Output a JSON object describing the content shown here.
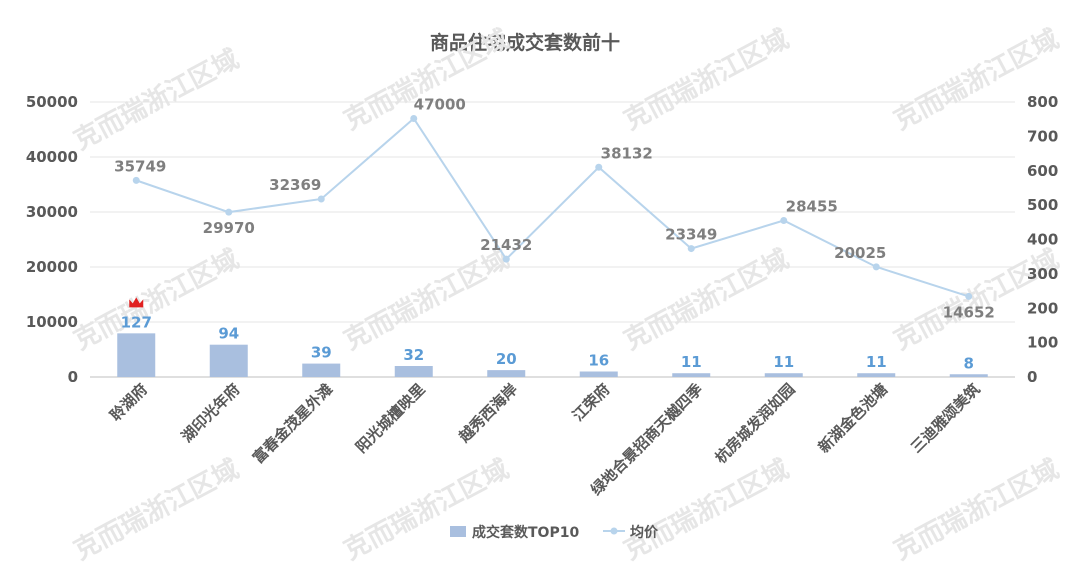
{
  "chart_data": {
    "type": "bar+line",
    "title": "商品住宅成交套数前十",
    "categories": [
      "聆湖府",
      "湖印光年府",
      "富春金茂星外滩",
      "阳光城檀映里",
      "越秀西海岸",
      "江荣府",
      "绿地合景招商天樾四季",
      "杭房城发润如园",
      "新湖金色池塘",
      "三迪雅颂美筑"
    ],
    "series": [
      {
        "name": "成交套数TOP10",
        "type": "bar",
        "axis": "right",
        "values": [
          127,
          94,
          39,
          32,
          20,
          16,
          11,
          11,
          11,
          8
        ]
      },
      {
        "name": "均价",
        "type": "line",
        "axis": "left",
        "values": [
          35749,
          29970,
          32369,
          47000,
          21432,
          38132,
          23349,
          28455,
          20025,
          14652
        ]
      }
    ],
    "left_axis": {
      "min": 0,
      "max": 50000,
      "ticks": [
        0,
        10000,
        20000,
        30000,
        40000,
        50000
      ]
    },
    "right_axis": {
      "min": 0,
      "max": 800,
      "ticks": [
        0,
        100,
        200,
        300,
        400,
        500,
        600,
        700,
        800
      ]
    },
    "grid": true,
    "legend": "bottom",
    "colors": {
      "bar": "#a9bfdf",
      "line": "#b8d4ec",
      "bar_label": "#5b9bd5",
      "line_label": "#7f7f7f",
      "crown": "#e02020"
    },
    "top_marker_icon": "crown-icon"
  },
  "watermark": "克而瑞浙江区域"
}
